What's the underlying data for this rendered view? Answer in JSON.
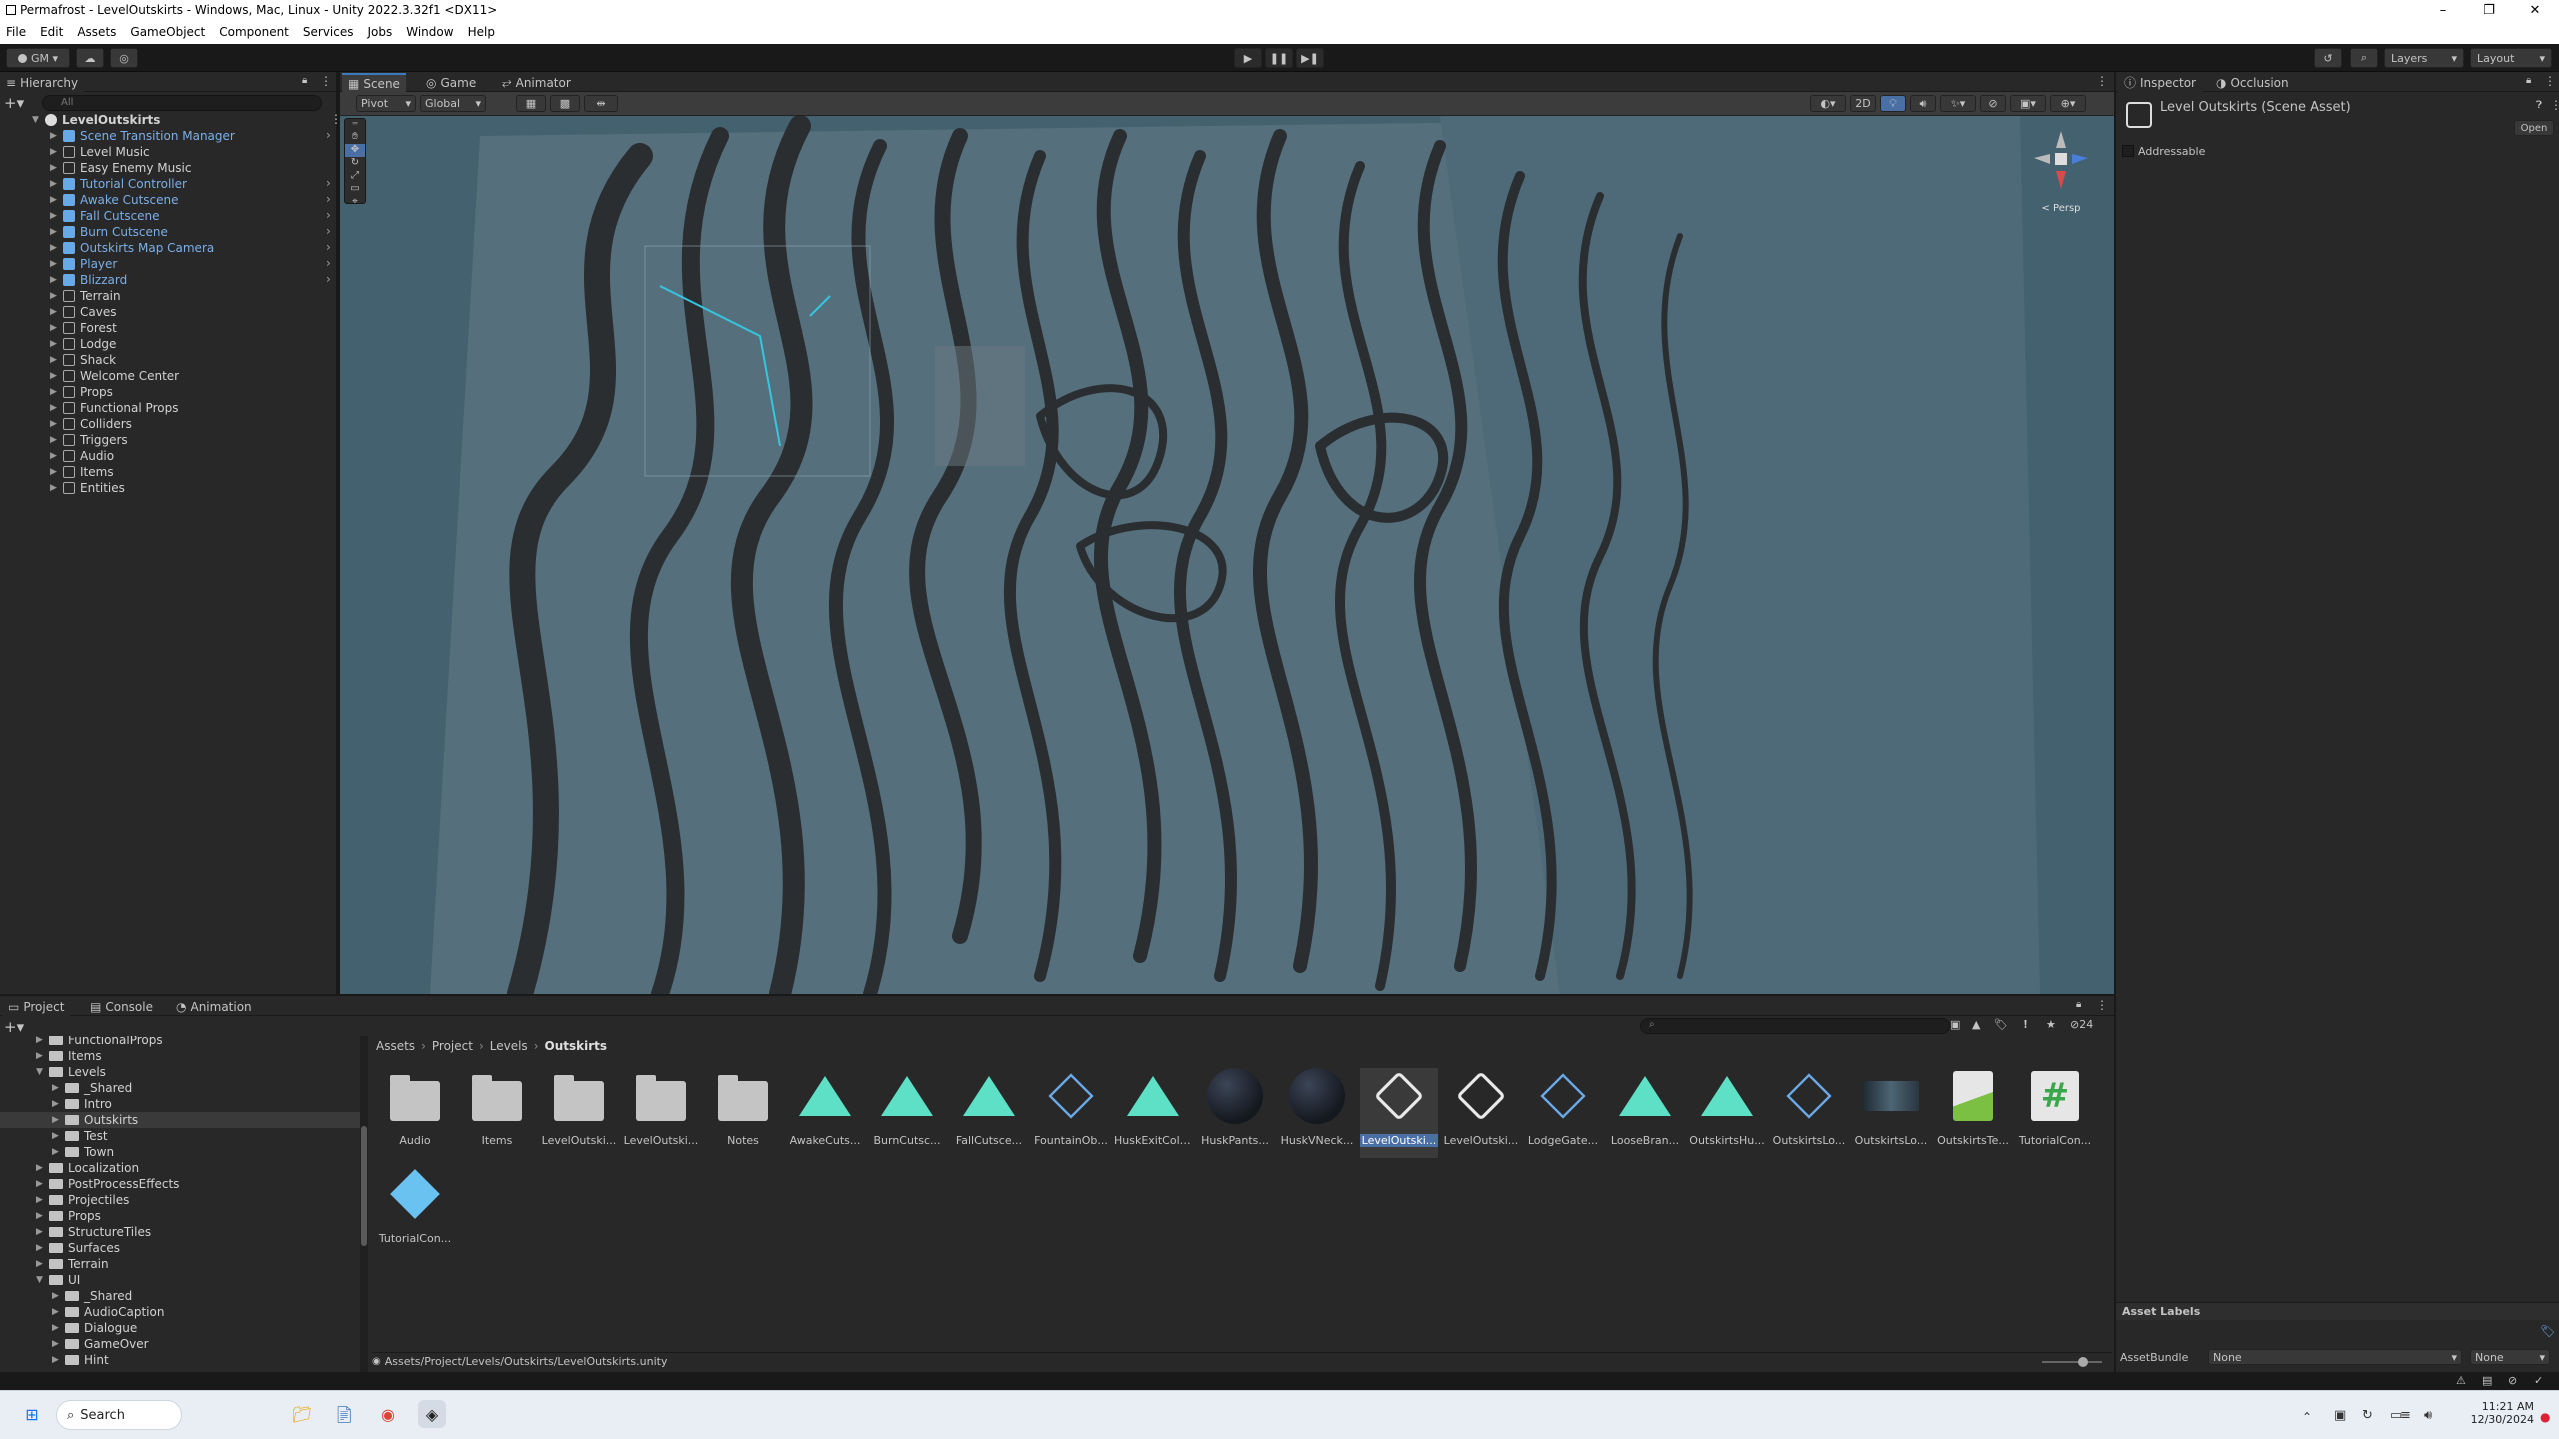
{
  "window": {
    "title": "Permafrost - LevelOutskirts - Windows, Mac, Linux - Unity 2022.3.32f1 <DX11>"
  },
  "menu": [
    "File",
    "Edit",
    "Assets",
    "GameObject",
    "Component",
    "Services",
    "Jobs",
    "Window",
    "Help"
  ],
  "toolbar": {
    "account": "GM",
    "layers": "Layers",
    "layout": "Layout"
  },
  "hierarchy": {
    "title": "Hierarchy",
    "search_placeholder": "All",
    "scene": "LevelOutskirts",
    "items": [
      {
        "label": "Scene Transition Manager",
        "prefab": true
      },
      {
        "label": "Level Music",
        "prefab": false
      },
      {
        "label": "Easy Enemy Music",
        "prefab": false
      },
      {
        "label": "Tutorial Controller",
        "prefab": true
      },
      {
        "label": "Awake Cutscene",
        "prefab": true
      },
      {
        "label": "Fall Cutscene",
        "prefab": true
      },
      {
        "label": "Burn Cutscene",
        "prefab": true
      },
      {
        "label": "Outskirts Map Camera",
        "prefab": true
      },
      {
        "label": "Player",
        "prefab": true
      },
      {
        "label": "Blizzard",
        "prefab": true
      },
      {
        "label": "Terrain",
        "prefab": false
      },
      {
        "label": "Caves",
        "prefab": false
      },
      {
        "label": "Forest",
        "prefab": false
      },
      {
        "label": "Lodge",
        "prefab": false
      },
      {
        "label": "Shack",
        "prefab": false
      },
      {
        "label": "Welcome Center",
        "prefab": false
      },
      {
        "label": "Props",
        "prefab": false
      },
      {
        "label": "Functional Props",
        "prefab": false
      },
      {
        "label": "Colliders",
        "prefab": false
      },
      {
        "label": "Triggers",
        "prefab": false
      },
      {
        "label": "Audio",
        "prefab": false
      },
      {
        "label": "Items",
        "prefab": false
      },
      {
        "label": "Entities",
        "prefab": false
      }
    ]
  },
  "scene_tabs": [
    "Scene",
    "Game",
    "Animator"
  ],
  "scene_toolbar": {
    "pivot": "Pivot",
    "global": "Global",
    "mode2d": "2D",
    "persp": "< Persp"
  },
  "inspector": {
    "tabs": [
      "Inspector",
      "Occlusion"
    ],
    "asset_title": "Level Outskirts (Scene Asset)",
    "open_label": "Open",
    "addressable": "Addressable",
    "asset_labels": "Asset Labels",
    "assetbundle_label": "AssetBundle",
    "assetbundle_value": "None",
    "variant_value": "None"
  },
  "project": {
    "tabs": [
      "Project",
      "Console",
      "Animation"
    ],
    "breadcrumb": [
      "Assets",
      "Project",
      "Levels",
      "Outskirts"
    ],
    "count": "24",
    "path": "Assets/Project/Levels/Outskirts/LevelOutskirts.unity",
    "tree": [
      {
        "label": "FunctionalProps",
        "depth": 1
      },
      {
        "label": "Items",
        "depth": 1
      },
      {
        "label": "Levels",
        "depth": 1
      },
      {
        "label": "_Shared",
        "depth": 2
      },
      {
        "label": "Intro",
        "depth": 2
      },
      {
        "label": "Outskirts",
        "depth": 2
      },
      {
        "label": "Test",
        "depth": 2
      },
      {
        "label": "Town",
        "depth": 2
      },
      {
        "label": "Localization",
        "depth": 1
      },
      {
        "label": "PostProcessEffects",
        "depth": 1
      },
      {
        "label": "Projectiles",
        "depth": 1
      },
      {
        "label": "Props",
        "depth": 1
      },
      {
        "label": "StructureTiles",
        "depth": 1
      },
      {
        "label": "Surfaces",
        "depth": 1
      },
      {
        "label": "Terrain",
        "depth": 1
      },
      {
        "label": "UI",
        "depth": 1
      },
      {
        "label": "_Shared",
        "depth": 2
      },
      {
        "label": "AudioCaption",
        "depth": 2
      },
      {
        "label": "Dialogue",
        "depth": 2
      },
      {
        "label": "GameOver",
        "depth": 2
      },
      {
        "label": "Hint",
        "depth": 2
      }
    ],
    "assets": [
      {
        "label": "Audio",
        "kind": "folder"
      },
      {
        "label": "Items",
        "kind": "folder"
      },
      {
        "label": "LevelOutski...",
        "kind": "folder"
      },
      {
        "label": "LevelOutski...",
        "kind": "folder"
      },
      {
        "label": "Notes",
        "kind": "folder"
      },
      {
        "label": "AwakeCuts...",
        "kind": "timeline"
      },
      {
        "label": "BurnCutsc...",
        "kind": "timeline"
      },
      {
        "label": "FallCutsce...",
        "kind": "timeline"
      },
      {
        "label": "FountainOb...",
        "kind": "script-prefab"
      },
      {
        "label": "HuskExitColl...",
        "kind": "timeline"
      },
      {
        "label": "HuskPants...",
        "kind": "material"
      },
      {
        "label": "HuskVNeck...",
        "kind": "material"
      },
      {
        "label": "LevelOutski...",
        "kind": "unity"
      },
      {
        "label": "LevelOutski...",
        "kind": "unity"
      },
      {
        "label": "LodgeGate...",
        "kind": "script-prefab"
      },
      {
        "label": "LooseBran...",
        "kind": "timeline"
      },
      {
        "label": "OutskirtsHu...",
        "kind": "timeline"
      },
      {
        "label": "OutskirtsLo...",
        "kind": "script-prefab"
      },
      {
        "label": "OutskirtsLo...",
        "kind": "texture"
      },
      {
        "label": "OutskirtsTe...",
        "kind": "terrain"
      },
      {
        "label": "TutorialCon...",
        "kind": "csharp"
      },
      {
        "label": "TutorialCon...",
        "kind": "prefab"
      }
    ]
  },
  "taskbar": {
    "search": "Search",
    "time": "11:21 AM",
    "date": "12/30/2024"
  },
  "colors": {
    "accent": "#3a79bb",
    "prefab": "#7bafe8",
    "timeline": "#5ee0c6",
    "scene_bg": "#43606e"
  }
}
